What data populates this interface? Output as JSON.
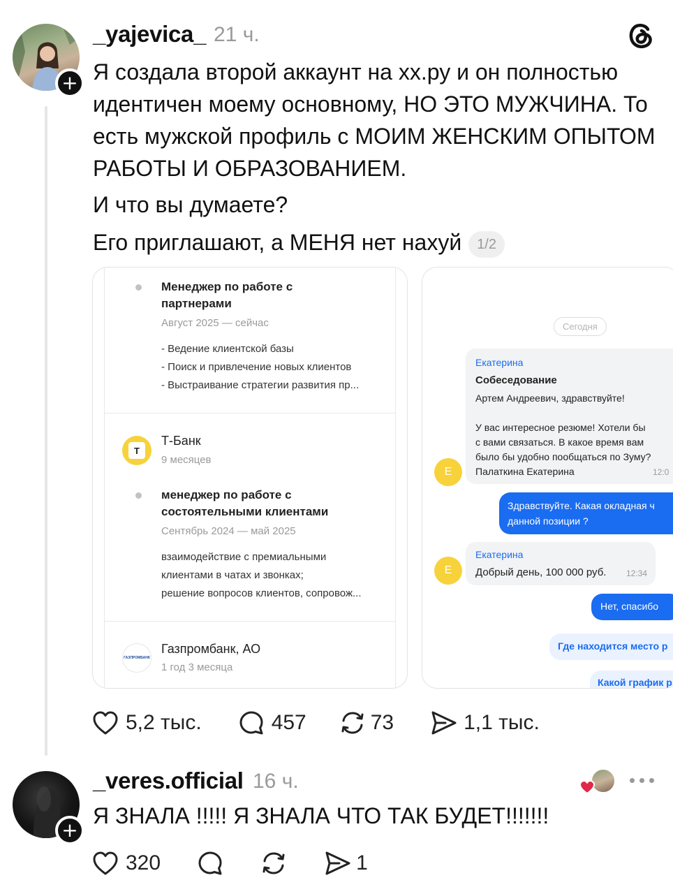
{
  "post": {
    "username": "_yajevica_",
    "time": "21 ч.",
    "paragraphs": [
      "Я создала второй аккаунт на хх.ру и он полностью идентичен моему основному, НО ЭТО МУЖЧИНА. То есть мужской профиль с МОИМ ЖЕНСКИМ ОПЫТОМ РАБОТЫ И ОБРАЗОВАНИЕМ.",
      "И что вы думаете?"
    ],
    "last_paragraph": "Его приглашают, а МЕНЯ нет нахуй",
    "pager": "1/2",
    "actions": {
      "likes": "5,2 тыс.",
      "comments": "457",
      "reposts": "73",
      "shares": "1,1 тыс."
    }
  },
  "resume": {
    "job1": {
      "title": "Менеджер по работе с партнерами",
      "period": "Август 2025 — сейчас",
      "duties": [
        "- Ведение клиентской базы",
        "- Поиск и привлечение новых клиентов",
        "- Выстраивание стратегии развития пр..."
      ]
    },
    "company2": {
      "name": "Т-Банк",
      "duration": "9 месяцев",
      "logo_letter": "T"
    },
    "job2": {
      "title": "менеджер по работе с состоятельными клиентами",
      "period": "Сентябрь 2024 — май 2025",
      "duties": [
        "взаимодействие с премиальными",
        "клиентами в чатах и звонках;",
        "решение вопросов клиентов, сопровож..."
      ]
    },
    "company3": {
      "name": "Газпромбанк, АО",
      "duration": "1 год 3 месяца",
      "logo_text": "ГАЗПРОМБАНК"
    }
  },
  "chat": {
    "date_chip": "Сегодня",
    "msg1": {
      "sender": "Екатерина",
      "subject": "Собеседование",
      "greeting": "Артем Андреевич, здравствуйте!",
      "body": [
        "У вас интересное резюме! Хотели бы",
        "с вами связаться. В какое время вам",
        "было бы удобно пообщаться по Зуму?"
      ],
      "signature": "Палаткина Екатерина",
      "time": "12:0"
    },
    "avatar_letter": "Е",
    "out1": [
      "Здравствуйте. Какая окладная ч",
      "данной позиции ?"
    ],
    "msg2": {
      "sender": "Екатерина",
      "text": "Добрый день, 100 000 руб.",
      "time": "12:34"
    },
    "out2": "Нет, спасибо",
    "out3": "Где находится место р",
    "out4": "Какой график р"
  },
  "reply": {
    "username": "_veres.official",
    "time": "16 ч.",
    "text": "Я ЗНАЛА !!!!! Я ЗНАЛА ЧТО ТАК БУДЕТ!!!!!!!",
    "actions": {
      "likes": "320",
      "shares": "1"
    }
  },
  "colors": {
    "accent_blue": "#1a6cf0",
    "like_red": "#e0284a",
    "tbank_yellow": "#f7d23a"
  }
}
